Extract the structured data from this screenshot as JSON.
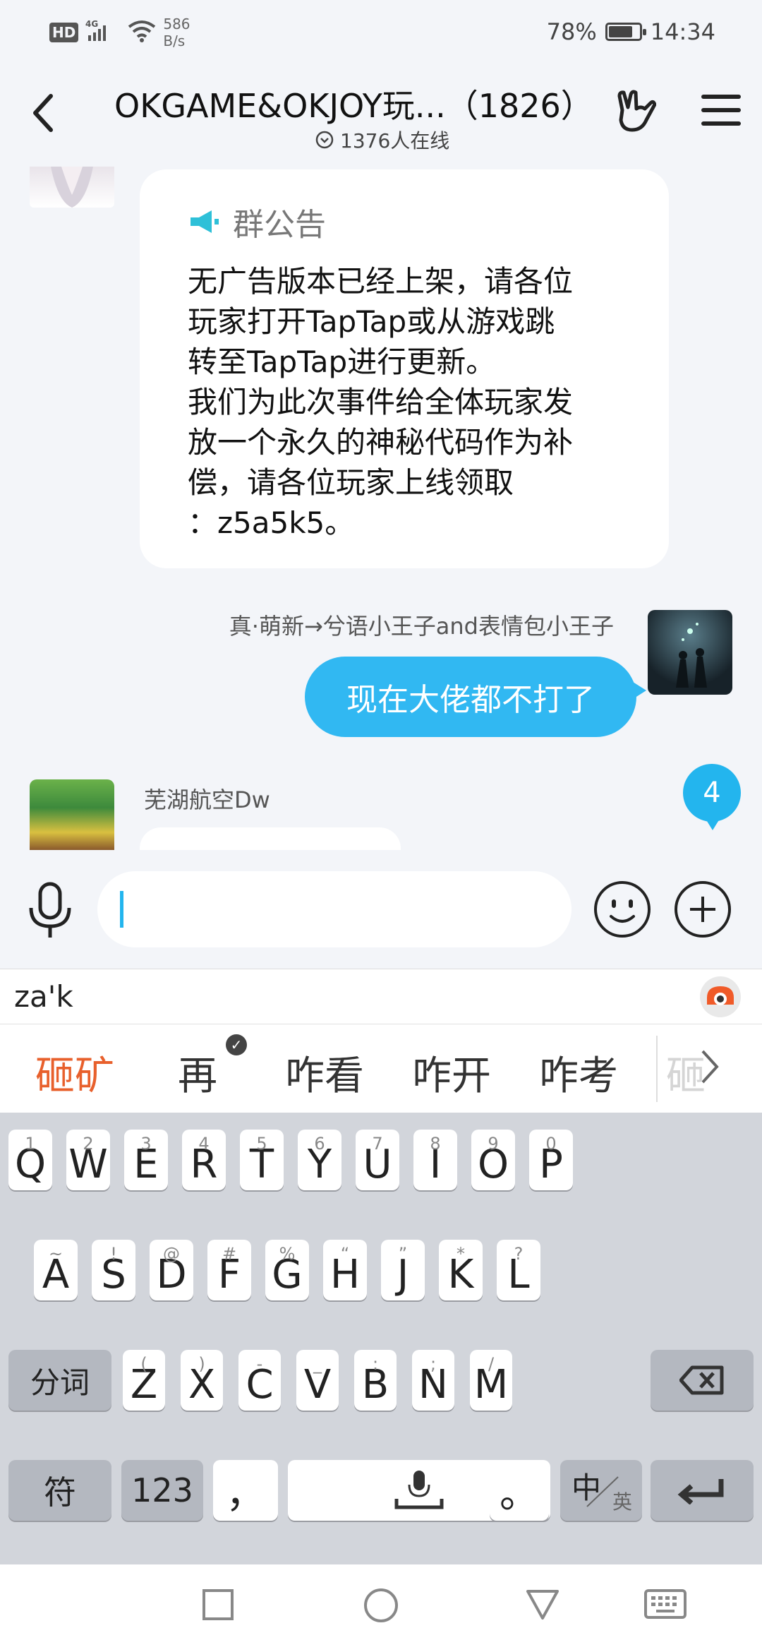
{
  "status_bar": {
    "hd": "HD",
    "network": "4G",
    "speed_value": "586",
    "speed_unit": "B/s",
    "battery_level": 0.78,
    "battery": "78%",
    "time": "14:34"
  },
  "header": {
    "title": "OKGAME&OKJOY玩...（1826）",
    "online": "1376人在线"
  },
  "notice": {
    "title": "群公告",
    "body": "无广告版本已经上架，请各位\n玩家打开TapTap或从游戏跳\n转至TapTap进行更新。\n我们为此次事件给全体玩家发\n放一个永久的神秘代码作为补\n偿，请各位玩家上线领取\n：z5a5k5。"
  },
  "messages": {
    "outgoing_sender": "真·萌新→兮语小王子and表情包小王子",
    "outgoing_text": "现在大佬都不打了",
    "incoming_sender": "芜湖航空Dw",
    "new_count": "4"
  },
  "ime": {
    "composing": "za'k",
    "candidates": [
      "砸矿",
      "再",
      "咋看",
      "咋开",
      "咋考",
      "砸"
    ],
    "rows": [
      [
        {
          "k": "Q",
          "h": "1"
        },
        {
          "k": "W",
          "h": "2"
        },
        {
          "k": "E",
          "h": "3"
        },
        {
          "k": "R",
          "h": "4"
        },
        {
          "k": "T",
          "h": "5"
        },
        {
          "k": "Y",
          "h": "6"
        },
        {
          "k": "U",
          "h": "7"
        },
        {
          "k": "I",
          "h": "8"
        },
        {
          "k": "O",
          "h": "9"
        },
        {
          "k": "P",
          "h": "0"
        }
      ],
      [
        {
          "k": "A",
          "h": "~"
        },
        {
          "k": "S",
          "h": "!"
        },
        {
          "k": "D",
          "h": "@"
        },
        {
          "k": "F",
          "h": "#"
        },
        {
          "k": "G",
          "h": "%"
        },
        {
          "k": "H",
          "h": "“"
        },
        {
          "k": "J",
          "h": "”"
        },
        {
          "k": "K",
          "h": "*"
        },
        {
          "k": "L",
          "h": "?"
        }
      ],
      [
        {
          "k": "Z",
          "h": "("
        },
        {
          "k": "X",
          "h": ")"
        },
        {
          "k": "C",
          "h": "-"
        },
        {
          "k": "V",
          "h": "_"
        },
        {
          "k": "B",
          "h": ":"
        },
        {
          "k": "N",
          "h": ";"
        },
        {
          "k": "M",
          "h": "/"
        }
      ]
    ],
    "split_label": "分词",
    "symbol_label": "符",
    "num_label": "123",
    "comma": "，",
    "period": "。",
    "lang_main": "中",
    "lang_sub": "英"
  },
  "icons": {
    "back": "back-arrow-icon",
    "online": "online-chevron-icon",
    "hand": "rock-hand-icon",
    "menu": "menu-icon",
    "announce": "megaphone-icon",
    "mic": "microphone-icon",
    "emoji": "smile-icon",
    "plus": "plus-icon",
    "backspace": "backspace-icon",
    "enter": "enter-icon",
    "nav": [
      "recent-apps-icon",
      "home-icon",
      "back-triangle-icon",
      "keyboard-icon"
    ]
  },
  "colors": {
    "accent": "#31b8f2",
    "candidate_highlight": "#e8602c"
  }
}
